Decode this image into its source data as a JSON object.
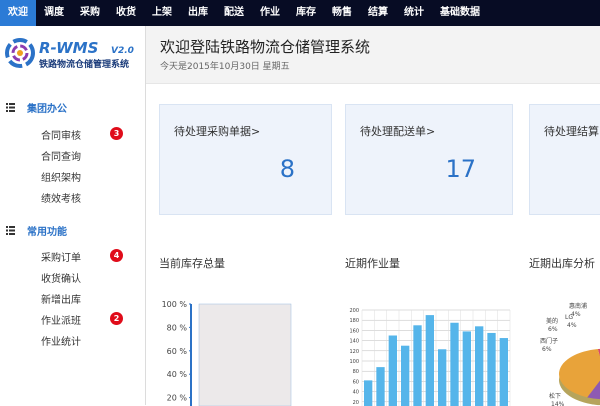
{
  "topnav": [
    {
      "label": "欢迎",
      "active": true
    },
    {
      "label": "调度"
    },
    {
      "label": "采购"
    },
    {
      "label": "收货"
    },
    {
      "label": "上架"
    },
    {
      "label": "出库"
    },
    {
      "label": "配送"
    },
    {
      "label": "作业"
    },
    {
      "label": "库存"
    },
    {
      "label": "畅售"
    },
    {
      "label": "结算"
    },
    {
      "label": "统计"
    },
    {
      "label": "基础数据"
    }
  ],
  "logo": {
    "brand": "R-WMS",
    "version": "V2.0",
    "subtitle": "铁路物流仓储管理系统"
  },
  "sidebar": {
    "groups": [
      {
        "title": "集团办公",
        "items": [
          {
            "label": "合同审核",
            "badge": "3"
          },
          {
            "label": "合同查询"
          },
          {
            "label": "组织架构"
          },
          {
            "label": "绩效考核"
          }
        ]
      },
      {
        "title": "常用功能",
        "items": [
          {
            "label": "采购订单",
            "badge": "4"
          },
          {
            "label": "收货确认"
          },
          {
            "label": "新增出库"
          },
          {
            "label": "作业派班",
            "badge": "2"
          },
          {
            "label": "作业统计"
          }
        ]
      }
    ]
  },
  "header": {
    "welcome": "欢迎登陆铁路物流仓储管理系统",
    "date": "今天是2015年10月30日 星期五"
  },
  "cards": [
    {
      "label": "待处理采购单据>",
      "value": "8"
    },
    {
      "label": "待处理配送单>",
      "value": "17"
    },
    {
      "label": "待处理结算"
    }
  ],
  "panels": {
    "stock": "当前库存总量",
    "work": "近期作业量",
    "outbound": "近期出库分析"
  },
  "colors": {
    "accent": "#2b7bd6",
    "nav_bg": "#070c24",
    "badge": "#e00c1a",
    "bar": "#55b5ea"
  },
  "chart_data": [
    {
      "type": "bar",
      "title": "当前库存总量",
      "ytick_labels": [
        "100 %",
        "80 %",
        "60 %",
        "40 %",
        "20 %"
      ],
      "ylim": [
        0,
        100
      ],
      "values": [
        100
      ],
      "note": "partially visible"
    },
    {
      "type": "bar",
      "title": "近期作业量",
      "ytick_labels": [
        "200",
        "180",
        "160",
        "140",
        "120",
        "100",
        "80",
        "60",
        "40",
        "20"
      ],
      "ylim": [
        0,
        200
      ],
      "values": [
        62,
        88,
        150,
        130,
        170,
        190,
        123,
        175,
        158,
        168,
        155,
        145
      ],
      "grid": true
    },
    {
      "type": "pie",
      "title": "近期出库分析",
      "slices": [
        {
          "label": "惠南浦",
          "value": 4,
          "color": "#d8486a"
        },
        {
          "label": "LG",
          "value": 4,
          "color": "#a6a6a6"
        },
        {
          "label": "美的",
          "value": 6,
          "color": "#3f86d0"
        },
        {
          "label": "西门子",
          "value": 6,
          "color": "#8e5ab3"
        },
        {
          "label": "松下",
          "value": 14,
          "color": "#e8a33a"
        }
      ],
      "labels": [
        {
          "name": "惠南浦",
          "pct": "4%"
        },
        {
          "name": "LG",
          "pct": "4%"
        },
        {
          "name": "美的",
          "pct": "6%"
        },
        {
          "name": "西门子",
          "pct": "6%"
        },
        {
          "name": "松下",
          "pct": "14%"
        }
      ],
      "note": "partially visible"
    }
  ]
}
